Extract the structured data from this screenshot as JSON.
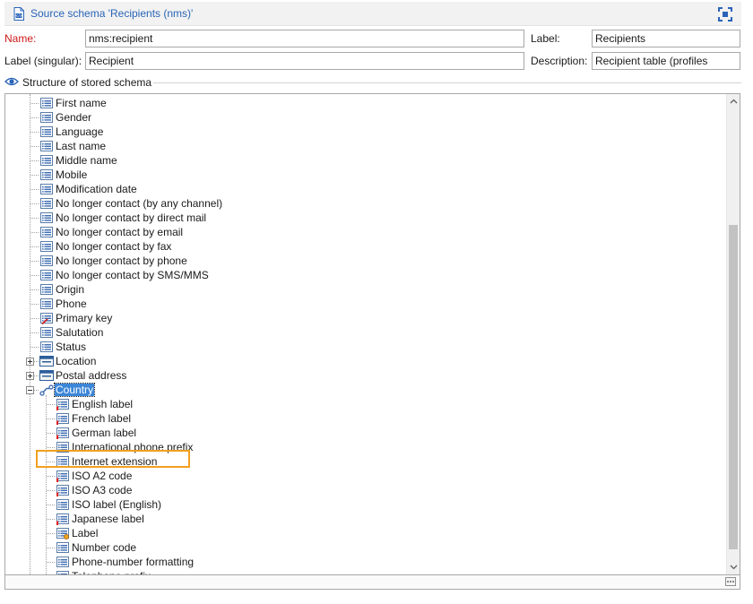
{
  "window": {
    "title": "Source schema 'Recipients (nms)'"
  },
  "form": {
    "name_label": "Name:",
    "name_value": "nms:recipient",
    "label_label": "Label:",
    "label_value": "Recipients",
    "singular_label": "Label (singular):",
    "singular_value": "Recipient",
    "description_label": "Description:",
    "description_value": "Recipient table (profiles"
  },
  "section": {
    "title": "Structure of stored schema"
  },
  "tree": {
    "items": [
      {
        "label": "First name",
        "icon": "attribute-icon",
        "level": 1
      },
      {
        "label": "Gender",
        "icon": "attribute-icon",
        "level": 1
      },
      {
        "label": "Language",
        "icon": "attribute-icon",
        "level": 1
      },
      {
        "label": "Last name",
        "icon": "attribute-icon",
        "level": 1
      },
      {
        "label": "Middle name",
        "icon": "attribute-icon",
        "level": 1
      },
      {
        "label": "Mobile",
        "icon": "attribute-icon",
        "level": 1
      },
      {
        "label": "Modification date",
        "icon": "attribute-icon",
        "level": 1
      },
      {
        "label": "No longer contact (by any channel)",
        "icon": "attribute-icon",
        "level": 1
      },
      {
        "label": "No longer contact by direct mail",
        "icon": "attribute-icon",
        "level": 1
      },
      {
        "label": "No longer contact by email",
        "icon": "attribute-icon",
        "level": 1
      },
      {
        "label": "No longer contact by fax",
        "icon": "attribute-icon",
        "level": 1
      },
      {
        "label": "No longer contact by phone",
        "icon": "attribute-icon",
        "level": 1
      },
      {
        "label": "No longer contact by SMS/MMS",
        "icon": "attribute-icon",
        "level": 1
      },
      {
        "label": "Origin",
        "icon": "attribute-icon",
        "level": 1
      },
      {
        "label": "Phone",
        "icon": "attribute-icon",
        "level": 1
      },
      {
        "label": "Primary key",
        "icon": "key-attribute-icon",
        "level": 1
      },
      {
        "label": "Salutation",
        "icon": "attribute-icon",
        "level": 1
      },
      {
        "label": "Status",
        "icon": "attribute-icon",
        "level": 1
      },
      {
        "label": "Location",
        "icon": "element-icon",
        "level": 1,
        "expander": "collapsed"
      },
      {
        "label": "Postal address",
        "icon": "element-icon",
        "level": 1,
        "expander": "collapsed"
      },
      {
        "label": "Country",
        "icon": "link-icon",
        "level": 1,
        "expander": "expanded",
        "selected": true
      },
      {
        "label": "English label",
        "icon": "attribute-sql-icon",
        "level": 2
      },
      {
        "label": "French label",
        "icon": "attribute-sql-icon",
        "level": 2
      },
      {
        "label": "German label",
        "icon": "attribute-sql-icon",
        "level": 2
      },
      {
        "label": "International phone prefix",
        "icon": "attribute-icon",
        "level": 2
      },
      {
        "label": "Internet extension",
        "icon": "attribute-icon",
        "level": 2
      },
      {
        "label": "ISO A2 code",
        "icon": "attribute-sql-icon",
        "level": 2
      },
      {
        "label": "ISO A3 code",
        "icon": "attribute-sql-icon",
        "level": 2
      },
      {
        "label": "ISO label (English)",
        "icon": "attribute-icon",
        "level": 2
      },
      {
        "label": "Japanese label",
        "icon": "attribute-sql-icon",
        "level": 2
      },
      {
        "label": "Label",
        "icon": "computed-attribute-icon",
        "level": 2
      },
      {
        "label": "Number code",
        "icon": "attribute-icon",
        "level": 2
      },
      {
        "label": "Phone-number formatting",
        "icon": "attribute-icon",
        "level": 2
      },
      {
        "label": "Telephone prefix",
        "icon": "attribute-icon",
        "level": 2
      }
    ]
  },
  "colors": {
    "title_text": "#2a64b8",
    "required_label": "#d01818",
    "selection": "#3c86d8",
    "highlight_box": "#f0a020"
  }
}
